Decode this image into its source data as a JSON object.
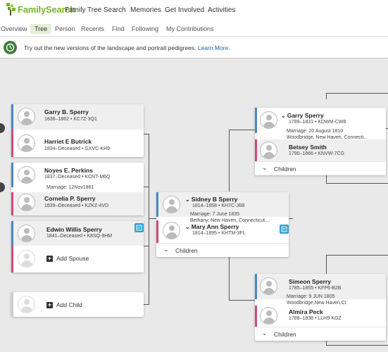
{
  "header": {
    "logo_text": "FamilySearch",
    "nav": [
      "Family Tree",
      "Search",
      "Memories",
      "Get Involved",
      "Activities"
    ]
  },
  "subnav": {
    "items": [
      "Overview",
      "Tree",
      "Person",
      "Recents",
      "Find",
      "Following",
      "My Contributions"
    ],
    "active": "Tree"
  },
  "banner": {
    "text": "Try out the new versions of the landscape and portrait pedigrees.",
    "link": "Learn More."
  },
  "left_column": {
    "couple1": {
      "husband": {
        "name": "Garry B. Sperry",
        "detail": "1836–1862 • KC7Z-3Q1"
      },
      "wife": {
        "name": "Harriet E Butrick",
        "detail": "1834–Deceased • GXVC-KH9"
      }
    },
    "couple2": {
      "husband": {
        "name": "Noyes E. Perkins",
        "detail": "1837–Deceased • KCNT-M6Q"
      },
      "marriage": "Marriage: 12Nov1861",
      "wife": {
        "name": "Cornelia P. Sperry",
        "detail": "1839–Deceased • KZKZ-4VD"
      }
    },
    "couple3": {
      "husband": {
        "name": "Edwin Willis Sperry",
        "detail": "1841–Deceased • K8SQ-9HM"
      },
      "add_spouse": "Add Spouse"
    },
    "add_child": "Add Child"
  },
  "center_couple": {
    "husband": {
      "name": "Sidney B Sperry",
      "detail": "1814–1858 • KH7C-J6B"
    },
    "marriage_line1": "Marriage: 7 June 1835",
    "marriage_line2": "Bethany, New Haven, Connecticut,...",
    "wife": {
      "name": "Mary Ann Sperry",
      "detail": "1814–1895 • KHTM-3FL"
    },
    "children": "Children"
  },
  "right_top_couple": {
    "husband": {
      "name": "Garry Sperry",
      "detail": "1789–1831 • KDWM-CW6"
    },
    "marriage_line1": "Marriage: 20 August 1810",
    "marriage_line2": "Woodbridge, New Haven, Connecti...",
    "wife": {
      "name": "Betsey Smith",
      "detail": "1790–1866 • KNVW-7CG"
    },
    "children": "Children"
  },
  "right_bottom_couple": {
    "husband": {
      "name": "Simeon Sperry",
      "detail": "1785–1855 • KFP6-B2B"
    },
    "marriage_line1": "Marriage: 9 JUN 1805",
    "marriage_line2": "Woodbridge,New Haven,Ct",
    "wife": {
      "name": "Almira Peck",
      "detail": "1788–1838 • LLH9-KGZ"
    },
    "children": "Children"
  },
  "colors": {
    "brand_green": "#7ab32e",
    "male": "#4a86c9",
    "female": "#d14a7c",
    "link": "#1d5fa3",
    "canvas": "#e9e9e9"
  },
  "icons": {
    "logo": "familysearch-tree-icon",
    "banner": "info-clock-icon",
    "avatar": "person-silhouette-icon",
    "note": "note-icon",
    "chevron": "chevron-down-icon",
    "add": "plus-icon"
  }
}
